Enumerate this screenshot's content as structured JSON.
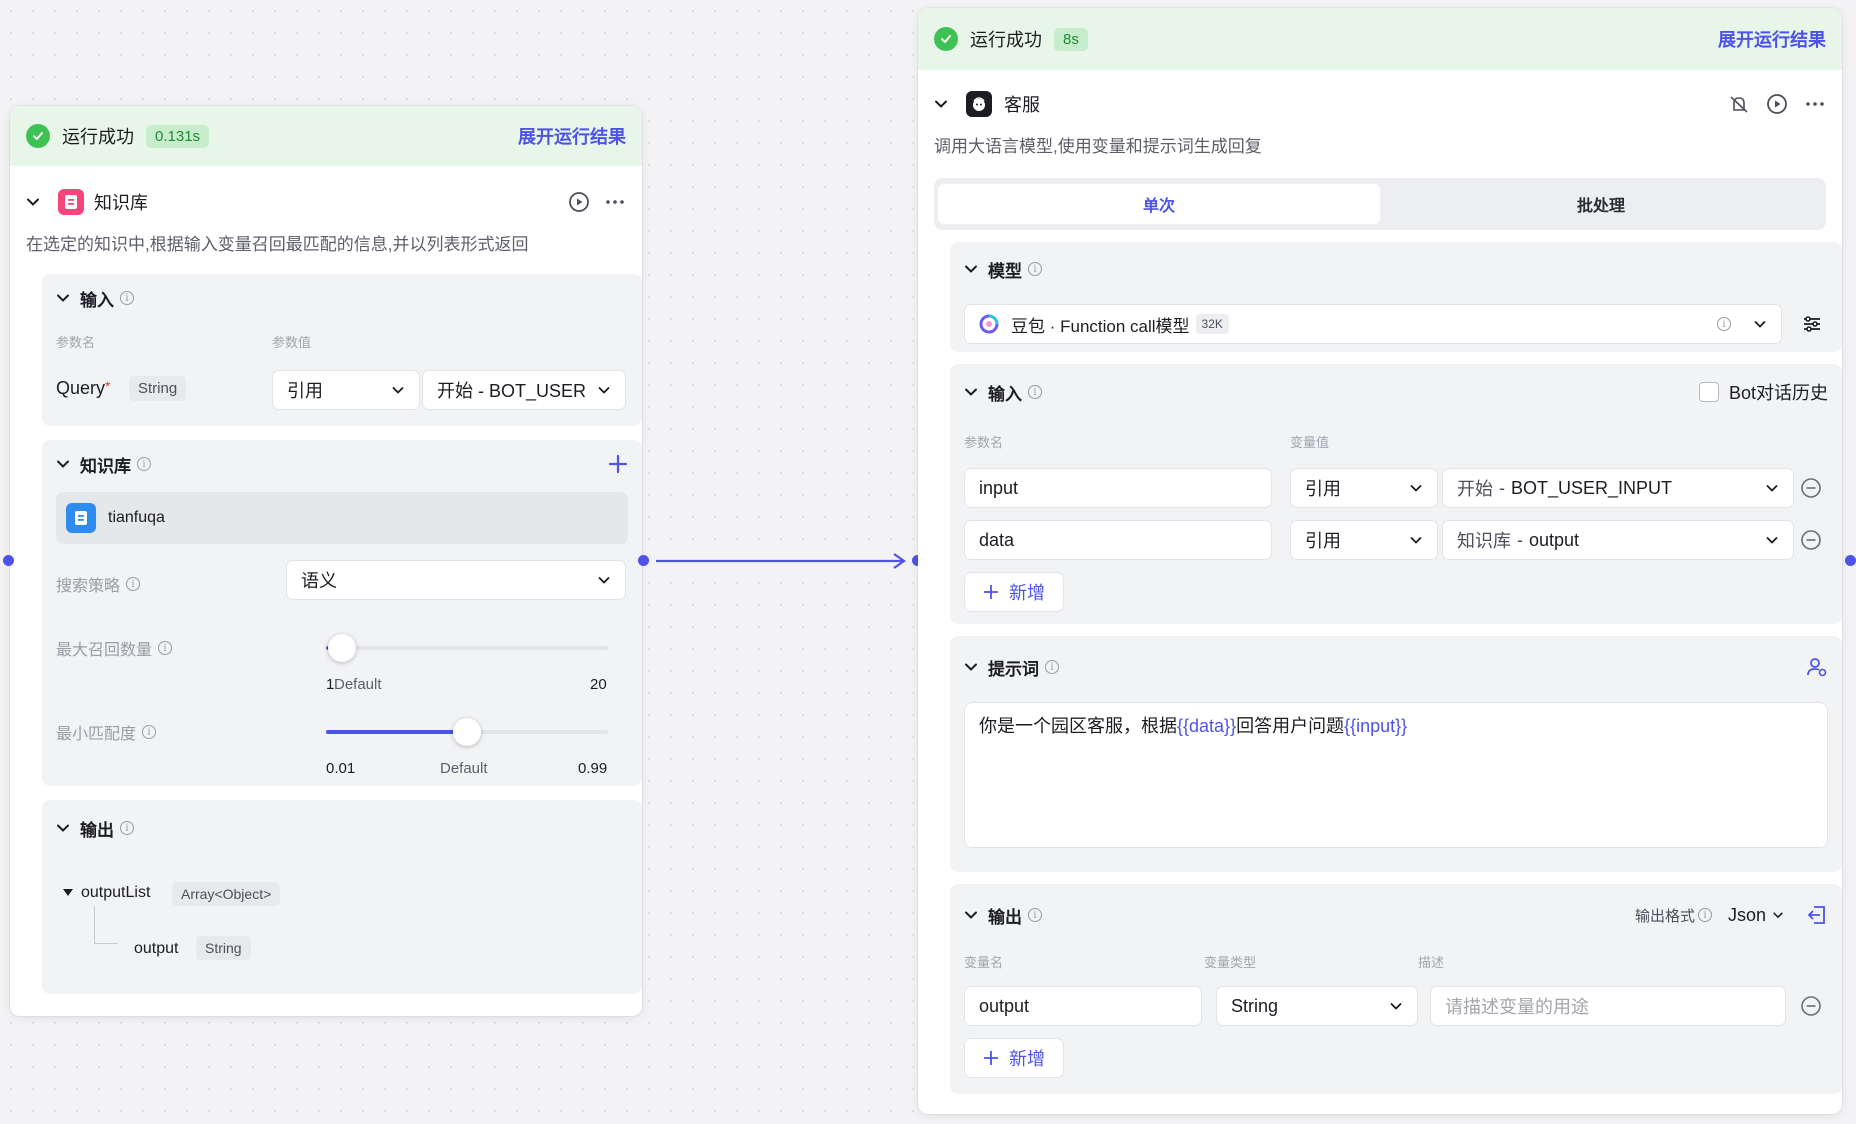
{
  "left_node": {
    "status_text": "运行成功",
    "time": "0.131s",
    "expand_label": "展开运行结果",
    "title": "知识库",
    "description": "在选定的知识中,根据输入变量召回最匹配的信息,并以列表形式返回",
    "input": {
      "title": "输入",
      "col_name": "参数名",
      "col_value": "参数值",
      "param_name": "Query",
      "required_mark": "*",
      "param_type": "String",
      "ref_mode": "引用",
      "ref_value": "开始 - BOT_USER"
    },
    "knowledge": {
      "title": "知识库",
      "item": "tianfuqa",
      "strategy_label": "搜索策略",
      "strategy_value": "语义",
      "max_recall_label": "最大召回数量",
      "max_recall": {
        "min": "1",
        "default_label": "Default",
        "max": "20",
        "value": 1
      },
      "min_match_label": "最小匹配度",
      "min_match": {
        "min": "0.01",
        "default_label": "Default",
        "max": "0.99",
        "value": 0.5
      }
    },
    "output": {
      "title": "输出",
      "list_name": "outputList",
      "list_type": "Array<Object>",
      "child_name": "output",
      "child_type": "String"
    }
  },
  "right_node": {
    "status_text": "运行成功",
    "time": "8s",
    "expand_label": "展开运行结果",
    "title": "客服",
    "description": "调用大语言模型,使用变量和提示词生成回复",
    "tabs": [
      "单次",
      "批处理"
    ],
    "active_tab": "单次",
    "model": {
      "title": "模型",
      "name": "豆包 · Function call模型",
      "badge": "32K"
    },
    "input": {
      "title": "输入",
      "history_label": "Bot对话历史",
      "col_name": "参数名",
      "col_value": "变量值",
      "rows": [
        {
          "name": "input",
          "mode": "引用",
          "source": "开始",
          "var": "BOT_USER_INPUT"
        },
        {
          "name": "data",
          "mode": "引用",
          "source": "知识库",
          "var": "output"
        }
      ],
      "add_label": "新增"
    },
    "prompt": {
      "title": "提示词",
      "text_1": "你是一个园区客服，根据",
      "var_1": "{{data}}",
      "text_2": "回答用户问题",
      "var_2": "{{input}}"
    },
    "output": {
      "title": "输出",
      "format_label": "输出格式",
      "format_value": "Json",
      "col_name": "变量名",
      "col_type": "变量类型",
      "col_desc": "描述",
      "row_name": "output",
      "row_type": "String",
      "desc_placeholder": "请描述变量的用途",
      "add_label": "新增"
    }
  },
  "colors": {
    "accent": "#4d53e8",
    "success": "#3ec254",
    "success_bg": "#e8f6ea"
  }
}
